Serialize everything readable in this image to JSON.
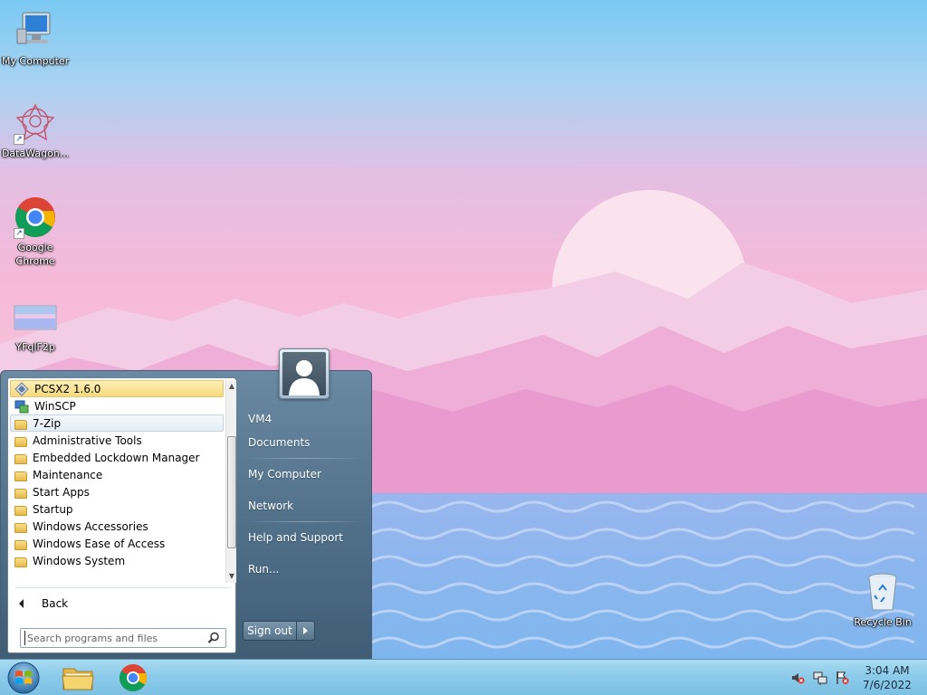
{
  "desktop": {
    "icons": [
      {
        "label": "My Computer"
      },
      {
        "label": "DataWagon..."
      },
      {
        "label": "Google Chrome"
      },
      {
        "label": "YFqlF2p"
      },
      {
        "label": "Recycle Bin"
      }
    ]
  },
  "start_menu": {
    "programs": [
      {
        "label": "PCSX2 1.6.0",
        "icon": "pcsx2-icon"
      },
      {
        "label": "WinSCP",
        "icon": "winscp-icon"
      },
      {
        "label": "7-Zip",
        "icon": "folder-icon"
      },
      {
        "label": "Administrative Tools",
        "icon": "folder-icon"
      },
      {
        "label": "Embedded Lockdown Manager",
        "icon": "folder-icon"
      },
      {
        "label": "Maintenance",
        "icon": "folder-icon"
      },
      {
        "label": "Start Apps",
        "icon": "folder-icon"
      },
      {
        "label": "Startup",
        "icon": "folder-icon"
      },
      {
        "label": "Windows Accessories",
        "icon": "folder-icon"
      },
      {
        "label": "Windows Ease of Access",
        "icon": "folder-icon"
      },
      {
        "label": "Windows System",
        "icon": "folder-icon"
      }
    ],
    "back_label": "Back",
    "search_placeholder": "Search programs and files",
    "right_items": {
      "user": "VM4",
      "documents": "Documents",
      "my_computer": "My Computer",
      "network": "Network",
      "help": "Help and Support",
      "run": "Run..."
    },
    "sign_out_label": "Sign out"
  },
  "taskbar": {
    "pinned": [
      "file-explorer-icon",
      "chrome-icon"
    ],
    "clock_time": "3:04 AM",
    "clock_date": "7/6/2022"
  },
  "colors": {
    "highlight": "#f6d97e",
    "start_menu": "#50708a",
    "taskbar": "#8ccbea"
  }
}
